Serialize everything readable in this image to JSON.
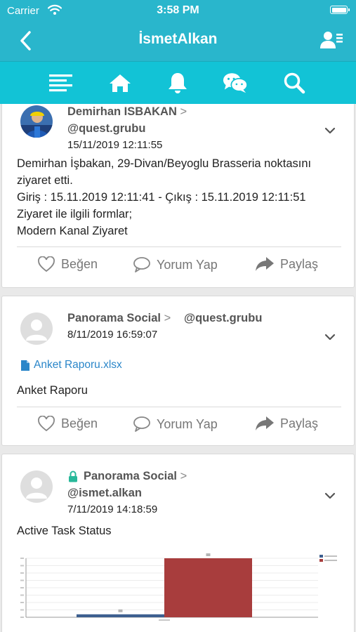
{
  "status_bar": {
    "carrier": "Carrier",
    "time": "3:58 PM"
  },
  "nav": {
    "title": "İsmetAlkan"
  },
  "toolbar": {
    "icons": [
      "menu-icon",
      "home-icon",
      "bell-icon",
      "chat-icon",
      "search-icon"
    ]
  },
  "posts": [
    {
      "author": "Demirhan ISBAKAN",
      "separator": ">",
      "group": "@quest.grubu",
      "date": "15/11/2019 12:11:55",
      "body": [
        "Demirhan İşbakan, 29-Divan/Beyoglu Brasseria noktasını",
        "ziyaret etti.",
        "Giriş : 15.11.2019 12:11:41 - Çıkış : 15.11.2019 12:11:51",
        "Ziyaret ile ilgili formlar;",
        "Modern Kanal Ziyaret"
      ]
    },
    {
      "author": "Panorama Social",
      "separator": ">",
      "group": "@quest.grubu",
      "date": "8/11/2019 16:59:07",
      "attachment": "Anket Raporu.xlsx",
      "body": [
        "Anket Raporu"
      ]
    },
    {
      "author": "Panorama Social",
      "separator": ">",
      "group": "@ismet.alkan",
      "date": "7/11/2019 14:18:59",
      "body": [
        "Active Task Status"
      ],
      "locked": true
    }
  ],
  "actions": {
    "like": "Beğen",
    "comment": "Yorum Yap",
    "share": "Paylaş"
  },
  "colors": {
    "header": "#29b6cc",
    "toolbar": "#12c3d6",
    "link": "#2a86c9",
    "lock": "#27b89a"
  },
  "chart_data": {
    "type": "bar",
    "categories": [
      ""
    ],
    "series": [
      {
        "values": [
          5
        ]
      },
      {
        "values": [
          100
        ]
      }
    ]
  }
}
